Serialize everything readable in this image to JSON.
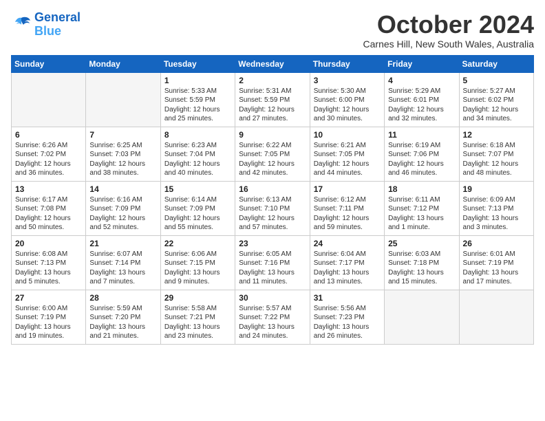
{
  "logo": {
    "line1": "General",
    "line2": "Blue"
  },
  "title": "October 2024",
  "subtitle": "Carnes Hill, New South Wales, Australia",
  "headers": [
    "Sunday",
    "Monday",
    "Tuesday",
    "Wednesday",
    "Thursday",
    "Friday",
    "Saturday"
  ],
  "weeks": [
    [
      {
        "day": "",
        "info": ""
      },
      {
        "day": "",
        "info": ""
      },
      {
        "day": "1",
        "info": "Sunrise: 5:33 AM\nSunset: 5:59 PM\nDaylight: 12 hours\nand 25 minutes."
      },
      {
        "day": "2",
        "info": "Sunrise: 5:31 AM\nSunset: 5:59 PM\nDaylight: 12 hours\nand 27 minutes."
      },
      {
        "day": "3",
        "info": "Sunrise: 5:30 AM\nSunset: 6:00 PM\nDaylight: 12 hours\nand 30 minutes."
      },
      {
        "day": "4",
        "info": "Sunrise: 5:29 AM\nSunset: 6:01 PM\nDaylight: 12 hours\nand 32 minutes."
      },
      {
        "day": "5",
        "info": "Sunrise: 5:27 AM\nSunset: 6:02 PM\nDaylight: 12 hours\nand 34 minutes."
      }
    ],
    [
      {
        "day": "6",
        "info": "Sunrise: 6:26 AM\nSunset: 7:02 PM\nDaylight: 12 hours\nand 36 minutes."
      },
      {
        "day": "7",
        "info": "Sunrise: 6:25 AM\nSunset: 7:03 PM\nDaylight: 12 hours\nand 38 minutes."
      },
      {
        "day": "8",
        "info": "Sunrise: 6:23 AM\nSunset: 7:04 PM\nDaylight: 12 hours\nand 40 minutes."
      },
      {
        "day": "9",
        "info": "Sunrise: 6:22 AM\nSunset: 7:05 PM\nDaylight: 12 hours\nand 42 minutes."
      },
      {
        "day": "10",
        "info": "Sunrise: 6:21 AM\nSunset: 7:05 PM\nDaylight: 12 hours\nand 44 minutes."
      },
      {
        "day": "11",
        "info": "Sunrise: 6:19 AM\nSunset: 7:06 PM\nDaylight: 12 hours\nand 46 minutes."
      },
      {
        "day": "12",
        "info": "Sunrise: 6:18 AM\nSunset: 7:07 PM\nDaylight: 12 hours\nand 48 minutes."
      }
    ],
    [
      {
        "day": "13",
        "info": "Sunrise: 6:17 AM\nSunset: 7:08 PM\nDaylight: 12 hours\nand 50 minutes."
      },
      {
        "day": "14",
        "info": "Sunrise: 6:16 AM\nSunset: 7:09 PM\nDaylight: 12 hours\nand 52 minutes."
      },
      {
        "day": "15",
        "info": "Sunrise: 6:14 AM\nSunset: 7:09 PM\nDaylight: 12 hours\nand 55 minutes."
      },
      {
        "day": "16",
        "info": "Sunrise: 6:13 AM\nSunset: 7:10 PM\nDaylight: 12 hours\nand 57 minutes."
      },
      {
        "day": "17",
        "info": "Sunrise: 6:12 AM\nSunset: 7:11 PM\nDaylight: 12 hours\nand 59 minutes."
      },
      {
        "day": "18",
        "info": "Sunrise: 6:11 AM\nSunset: 7:12 PM\nDaylight: 13 hours\nand 1 minute."
      },
      {
        "day": "19",
        "info": "Sunrise: 6:09 AM\nSunset: 7:13 PM\nDaylight: 13 hours\nand 3 minutes."
      }
    ],
    [
      {
        "day": "20",
        "info": "Sunrise: 6:08 AM\nSunset: 7:13 PM\nDaylight: 13 hours\nand 5 minutes."
      },
      {
        "day": "21",
        "info": "Sunrise: 6:07 AM\nSunset: 7:14 PM\nDaylight: 13 hours\nand 7 minutes."
      },
      {
        "day": "22",
        "info": "Sunrise: 6:06 AM\nSunset: 7:15 PM\nDaylight: 13 hours\nand 9 minutes."
      },
      {
        "day": "23",
        "info": "Sunrise: 6:05 AM\nSunset: 7:16 PM\nDaylight: 13 hours\nand 11 minutes."
      },
      {
        "day": "24",
        "info": "Sunrise: 6:04 AM\nSunset: 7:17 PM\nDaylight: 13 hours\nand 13 minutes."
      },
      {
        "day": "25",
        "info": "Sunrise: 6:03 AM\nSunset: 7:18 PM\nDaylight: 13 hours\nand 15 minutes."
      },
      {
        "day": "26",
        "info": "Sunrise: 6:01 AM\nSunset: 7:19 PM\nDaylight: 13 hours\nand 17 minutes."
      }
    ],
    [
      {
        "day": "27",
        "info": "Sunrise: 6:00 AM\nSunset: 7:19 PM\nDaylight: 13 hours\nand 19 minutes."
      },
      {
        "day": "28",
        "info": "Sunrise: 5:59 AM\nSunset: 7:20 PM\nDaylight: 13 hours\nand 21 minutes."
      },
      {
        "day": "29",
        "info": "Sunrise: 5:58 AM\nSunset: 7:21 PM\nDaylight: 13 hours\nand 23 minutes."
      },
      {
        "day": "30",
        "info": "Sunrise: 5:57 AM\nSunset: 7:22 PM\nDaylight: 13 hours\nand 24 minutes."
      },
      {
        "day": "31",
        "info": "Sunrise: 5:56 AM\nSunset: 7:23 PM\nDaylight: 13 hours\nand 26 minutes."
      },
      {
        "day": "",
        "info": ""
      },
      {
        "day": "",
        "info": ""
      }
    ]
  ]
}
